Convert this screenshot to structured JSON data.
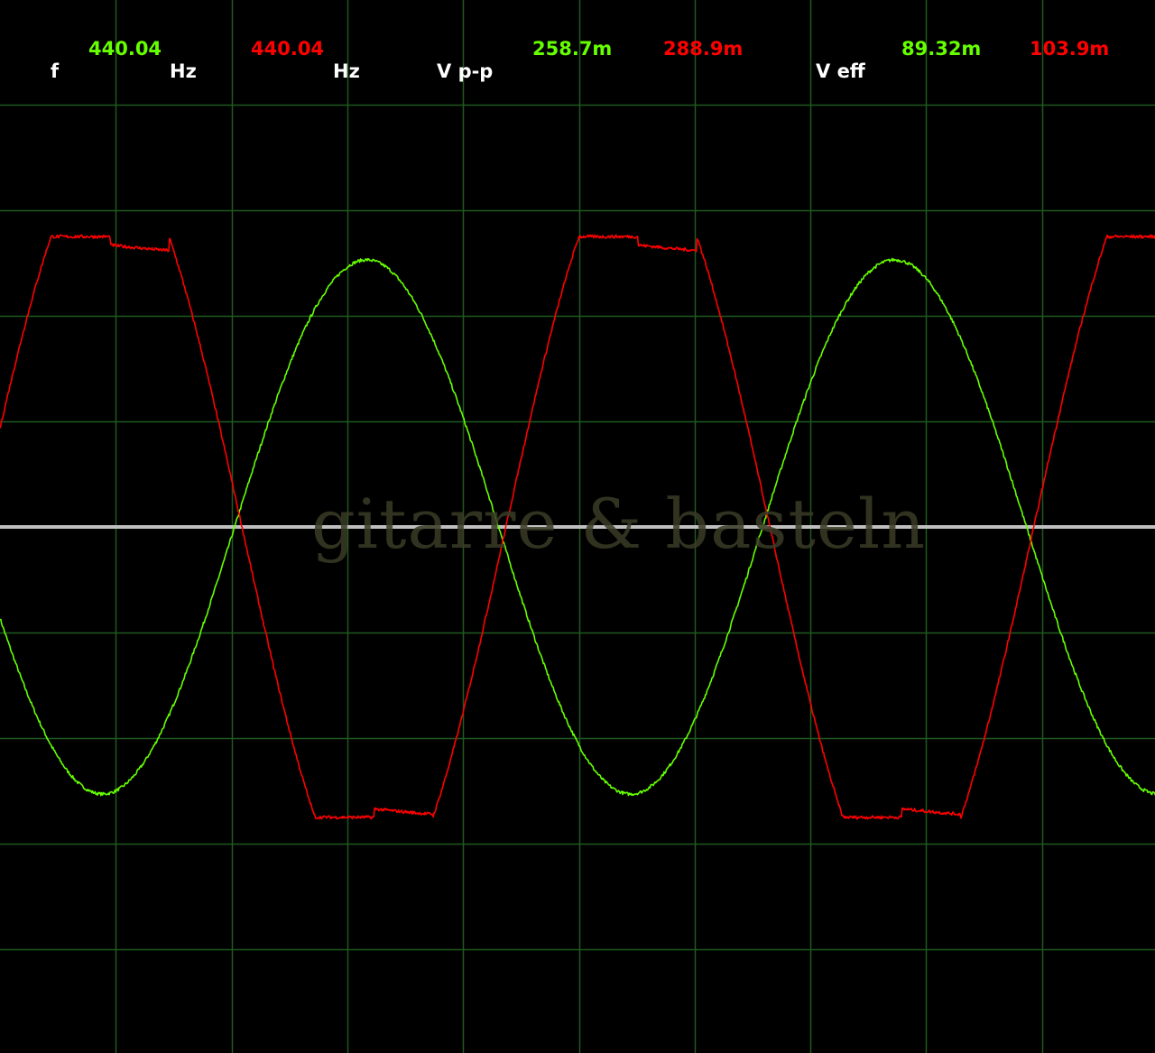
{
  "readouts": {
    "frequency": {
      "label": "f",
      "ch1_value": "440.04",
      "ch1_unit": "Hz",
      "ch2_value": "440.04",
      "ch2_unit": "Hz"
    },
    "vpp": {
      "label": "V p-p",
      "ch1_value": "258.7m",
      "ch2_value": "288.9m"
    },
    "veff": {
      "label": "V eff",
      "ch1_value": "89.32m",
      "ch2_value": "103.9m"
    }
  },
  "watermark": "gitarre & basteln",
  "colors": {
    "background": "#000000",
    "grid": "#1f5a1f",
    "centerline": "#bfbfbf",
    "ch1": "#66ff00",
    "ch2": "#ff0000",
    "label": "#ffffff"
  },
  "chart_data": {
    "type": "line",
    "title": "",
    "xlabel": "",
    "ylabel": "",
    "grid": true,
    "grid_divisions": {
      "x": 10,
      "y": 10
    },
    "xlim": [
      0,
      10
    ],
    "ylim": [
      -5,
      5
    ],
    "series": [
      {
        "name": "",
        "color": "#66ff00",
        "frequency_hz": 440.04,
        "peak_to_peak": "258.7m",
        "rms": "89.32m",
        "waveform": "sine",
        "period_div": 4.56,
        "amplitude_div": 2.53,
        "offset_div": 0.0,
        "phase_deg": 200,
        "clip_div": null
      },
      {
        "name": "",
        "color": "#ff0000",
        "frequency_hz": 440.04,
        "peak_to_peak": "288.9m",
        "rms": "103.9m",
        "waveform": "clipped-sine",
        "period_div": 4.56,
        "amplitude_div": 3.6,
        "offset_div": 0.0,
        "phase_deg": 15,
        "clip_div": 2.75
      }
    ]
  }
}
